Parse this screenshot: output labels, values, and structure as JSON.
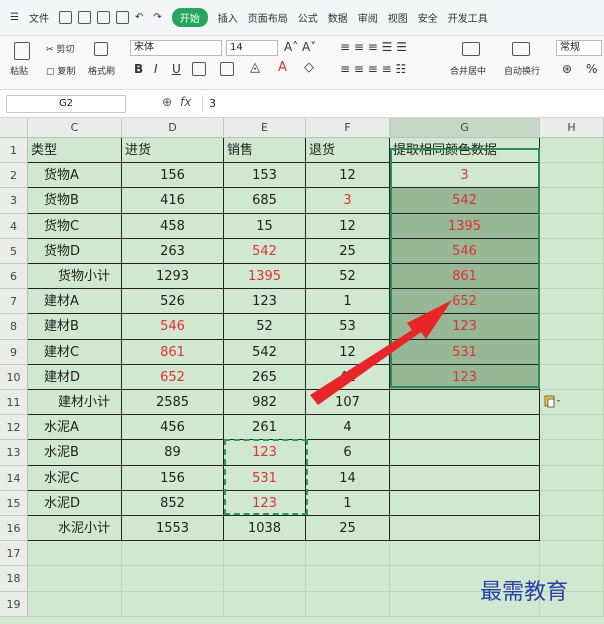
{
  "menu": {
    "file": "文件",
    "tabs": [
      "开始",
      "插入",
      "页面布局",
      "公式",
      "数据",
      "审阅",
      "视图",
      "安全",
      "开发工具"
    ],
    "active_tab": "开始"
  },
  "ribbon": {
    "paste": "粘贴",
    "cut": "剪切",
    "copy": "复制",
    "format_painter": "格式刷",
    "font_name": "宋体",
    "font_size": "14",
    "merge": "合并居中",
    "wrap": "自动换行",
    "number_format": "常规",
    "percent": "%"
  },
  "formula_bar": {
    "cell_ref": "G2",
    "fx": "fx",
    "value": "3"
  },
  "columns": [
    "C",
    "D",
    "E",
    "F",
    "G",
    "H"
  ],
  "rows": [
    {
      "num": "1",
      "cells": [
        {
          "v": "类型",
          "a": "l"
        },
        {
          "v": "进货",
          "a": "l"
        },
        {
          "v": "销售",
          "a": "l"
        },
        {
          "v": "退货",
          "a": "l"
        },
        {
          "v": "提取相同颜色数据",
          "a": "l"
        }
      ]
    },
    {
      "num": "2",
      "cells": [
        {
          "v": "货物A",
          "a": "l",
          "i": 1
        },
        {
          "v": "156"
        },
        {
          "v": "153"
        },
        {
          "v": "12"
        },
        {
          "v": "3",
          "c": "red"
        }
      ]
    },
    {
      "num": "3",
      "cells": [
        {
          "v": "货物B",
          "a": "l",
          "i": 1
        },
        {
          "v": "416"
        },
        {
          "v": "685"
        },
        {
          "v": "3",
          "c": "red"
        },
        {
          "v": "542",
          "c": "red",
          "s": 1
        }
      ]
    },
    {
      "num": "4",
      "cells": [
        {
          "v": "货物C",
          "a": "l",
          "i": 1
        },
        {
          "v": "458"
        },
        {
          "v": "15"
        },
        {
          "v": "12"
        },
        {
          "v": "1395",
          "c": "red",
          "s": 1
        }
      ]
    },
    {
      "num": "5",
      "cells": [
        {
          "v": "货物D",
          "a": "l",
          "i": 1
        },
        {
          "v": "263"
        },
        {
          "v": "542",
          "c": "red"
        },
        {
          "v": "25"
        },
        {
          "v": "546",
          "c": "red",
          "s": 1
        }
      ]
    },
    {
      "num": "6",
      "cells": [
        {
          "v": "货物小计",
          "a": "l",
          "i": 2
        },
        {
          "v": "1293"
        },
        {
          "v": "1395",
          "c": "red"
        },
        {
          "v": "52"
        },
        {
          "v": "861",
          "c": "red",
          "s": 1
        }
      ]
    },
    {
      "num": "7",
      "cells": [
        {
          "v": "建材A",
          "a": "l",
          "i": 1
        },
        {
          "v": "526"
        },
        {
          "v": "123"
        },
        {
          "v": "1"
        },
        {
          "v": "652",
          "c": "red",
          "s": 1
        }
      ]
    },
    {
      "num": "8",
      "cells": [
        {
          "v": "建材B",
          "a": "l",
          "i": 1
        },
        {
          "v": "546",
          "c": "red"
        },
        {
          "v": "52"
        },
        {
          "v": "53"
        },
        {
          "v": "123",
          "c": "red",
          "s": 1
        }
      ]
    },
    {
      "num": "9",
      "cells": [
        {
          "v": "建材C",
          "a": "l",
          "i": 1
        },
        {
          "v": "861",
          "c": "red"
        },
        {
          "v": "542"
        },
        {
          "v": "12"
        },
        {
          "v": "531",
          "c": "red",
          "s": 1
        }
      ]
    },
    {
      "num": "10",
      "cells": [
        {
          "v": "建材D",
          "a": "l",
          "i": 1
        },
        {
          "v": "652",
          "c": "red"
        },
        {
          "v": "265"
        },
        {
          "v": "41"
        },
        {
          "v": "123",
          "c": "red",
          "s": 1
        }
      ]
    },
    {
      "num": "11",
      "cells": [
        {
          "v": "建材小计",
          "a": "l",
          "i": 2
        },
        {
          "v": "2585"
        },
        {
          "v": "982"
        },
        {
          "v": "107"
        },
        {
          "v": ""
        }
      ]
    },
    {
      "num": "12",
      "cells": [
        {
          "v": "水泥A",
          "a": "l",
          "i": 1
        },
        {
          "v": "456"
        },
        {
          "v": "261"
        },
        {
          "v": "4"
        },
        {
          "v": ""
        }
      ]
    },
    {
      "num": "13",
      "cells": [
        {
          "v": "水泥B",
          "a": "l",
          "i": 1
        },
        {
          "v": "89"
        },
        {
          "v": "123",
          "c": "red"
        },
        {
          "v": "6"
        },
        {
          "v": ""
        }
      ]
    },
    {
      "num": "14",
      "cells": [
        {
          "v": "水泥C",
          "a": "l",
          "i": 1
        },
        {
          "v": "156"
        },
        {
          "v": "531",
          "c": "red"
        },
        {
          "v": "14"
        },
        {
          "v": ""
        }
      ]
    },
    {
      "num": "15",
      "cells": [
        {
          "v": "水泥D",
          "a": "l",
          "i": 1
        },
        {
          "v": "852"
        },
        {
          "v": "123",
          "c": "red"
        },
        {
          "v": "1"
        },
        {
          "v": ""
        }
      ]
    },
    {
      "num": "16",
      "cells": [
        {
          "v": "水泥小计",
          "a": "l",
          "i": 2
        },
        {
          "v": "1553"
        },
        {
          "v": "1038"
        },
        {
          "v": "25"
        },
        {
          "v": ""
        }
      ]
    },
    {
      "num": "17",
      "cells": []
    },
    {
      "num": "18",
      "cells": []
    },
    {
      "num": "19",
      "cells": []
    }
  ],
  "watermark": "最需教育",
  "colors": {
    "accent": "#26a65b",
    "red_text": "#e03232",
    "arrow": "#e8262a",
    "sheet_bg": "#cfe8cf",
    "selected": "#96b896"
  }
}
